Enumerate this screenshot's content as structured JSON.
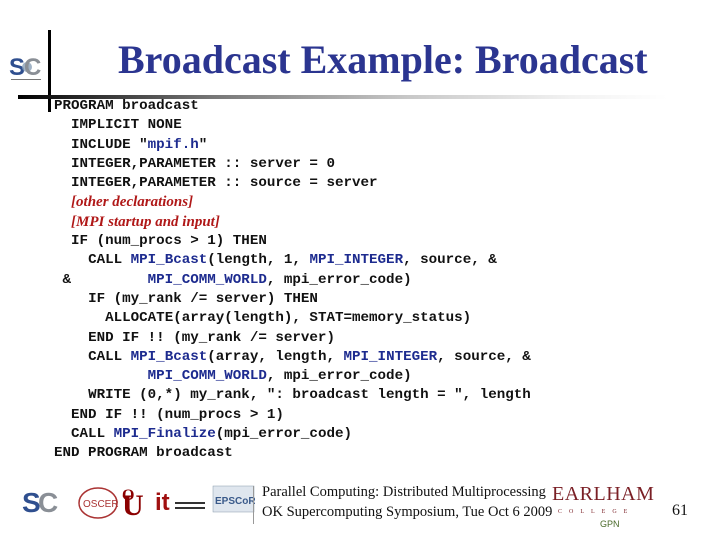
{
  "slide": {
    "title": "Broadcast Example: Broadcast",
    "page_number": "61"
  },
  "code": {
    "lines": [
      {
        "indent": "",
        "parts": [
          {
            "t": "PROGRAM broadcast"
          }
        ]
      },
      {
        "indent": "  ",
        "parts": [
          {
            "t": "IMPLICIT NONE"
          }
        ]
      },
      {
        "indent": "  ",
        "parts": [
          {
            "t": "INCLUDE \""
          },
          {
            "t": "mpif.h",
            "c": "blue"
          },
          {
            "t": "\""
          }
        ]
      },
      {
        "indent": "  ",
        "parts": [
          {
            "t": "INTEGER,PARAMETER :: server = 0"
          }
        ]
      },
      {
        "indent": "  ",
        "parts": [
          {
            "t": "INTEGER,PARAMETER :: source = server"
          }
        ]
      },
      {
        "indent": "  ",
        "parts": [
          {
            "t": "[other declarations]",
            "c": "comment"
          }
        ]
      },
      {
        "indent": "  ",
        "parts": [
          {
            "t": "[MPI startup and input]",
            "c": "comment"
          }
        ]
      },
      {
        "indent": "  ",
        "parts": [
          {
            "t": "IF (num_procs > 1) THEN"
          }
        ]
      },
      {
        "indent": "    ",
        "parts": [
          {
            "t": "CALL "
          },
          {
            "t": "MPI_Bcast",
            "c": "blue"
          },
          {
            "t": "(length, 1, "
          },
          {
            "t": "MPI_INTEGER",
            "c": "blue"
          },
          {
            "t": ", source, &"
          }
        ]
      },
      {
        "indent": " ",
        "parts": [
          {
            "t": "&         "
          },
          {
            "t": "MPI_COMM_WORLD",
            "c": "blue"
          },
          {
            "t": ", mpi_error_code)"
          }
        ]
      },
      {
        "indent": "    ",
        "parts": [
          {
            "t": "IF (my_rank /= server) THEN"
          }
        ]
      },
      {
        "indent": "      ",
        "parts": [
          {
            "t": "ALLOCATE(array(length), STAT=memory_status)"
          }
        ]
      },
      {
        "indent": "    ",
        "parts": [
          {
            "t": "END IF !! (my_rank /= server)"
          }
        ]
      },
      {
        "indent": "    ",
        "parts": [
          {
            "t": "CALL "
          },
          {
            "t": "MPI_Bcast",
            "c": "blue"
          },
          {
            "t": "(array, length, "
          },
          {
            "t": "MPI_INTEGER",
            "c": "blue"
          },
          {
            "t": ", source, &"
          }
        ]
      },
      {
        "indent": "           ",
        "parts": [
          {
            "t": "MPI_COMM_WORLD",
            "c": "blue"
          },
          {
            "t": ", mpi_error_code)"
          }
        ]
      },
      {
        "indent": "    ",
        "parts": [
          {
            "t": "WRITE (0,*) my_rank, \": broadcast length = \", length"
          }
        ]
      },
      {
        "indent": "  ",
        "parts": [
          {
            "t": "END IF !! (num_procs > 1)"
          }
        ]
      },
      {
        "indent": "  ",
        "parts": [
          {
            "t": "CALL "
          },
          {
            "t": "MPI_Finalize",
            "c": "blue"
          },
          {
            "t": "(mpi_error_code)"
          }
        ]
      },
      {
        "indent": "",
        "parts": [
          {
            "t": "END PROGRAM broadcast"
          }
        ]
      }
    ]
  },
  "footer": {
    "line1": "Parallel Computing: Distributed Multiprocessing",
    "line2": "OK Supercomputing Symposium, Tue Oct 6 2009",
    "logos": [
      "SC",
      "OSCER",
      "OU",
      "OU IT",
      "EPSCoR"
    ],
    "earlham": {
      "name": "EARLHAM",
      "college": "COLLEGE",
      "gpn": "GPN"
    }
  },
  "colors": {
    "title": "#2b3590",
    "code_identifier": "#1d2b8f",
    "comment": "#b01818",
    "earlham": "#7a1f25"
  }
}
